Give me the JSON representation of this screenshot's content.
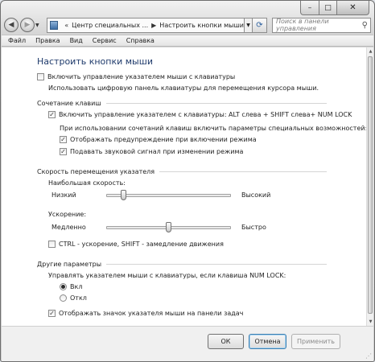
{
  "window": {
    "caption": {
      "minimize": "–",
      "maximize": "□",
      "close": "✕"
    }
  },
  "nav": {
    "back_glyph": "◀",
    "forward_glyph": "▶",
    "breadcrumb": [
      "Центр специальных ...",
      "Настроить кнопки мыши"
    ],
    "search_placeholder": "Поиск в панели управления"
  },
  "menu": [
    "Файл",
    "Правка",
    "Вид",
    "Сервис",
    "Справка"
  ],
  "page": {
    "title": "Настроить кнопки мыши",
    "enable_mousekeys": {
      "label": "Включить управление указателем мыши с клавиатуры",
      "checked": false
    },
    "enable_description": "Использовать цифровую панель клавиатуры для перемещения курсора мыши.",
    "shortcut": {
      "heading": "Сочетание клавиш",
      "enable_shortcut": {
        "label": "Включить управление указателем с клавиатуры: ALT слева + SHIFT слева+ NUM LOCK",
        "checked": true
      },
      "info": "При использовании сочетаний клавиш включить параметры специальных возможностей:",
      "warning": {
        "label": "Отображать предупреждение при включении режима",
        "checked": true
      },
      "sound": {
        "label": "Подавать звуковой сигнал при изменении режима",
        "checked": true
      }
    },
    "speed": {
      "heading": "Скорость перемещения указателя",
      "top_speed_label": "Наибольшая скорость:",
      "top_speed_min": "Низкий",
      "top_speed_max": "Высокий",
      "top_speed_value": 0.12,
      "accel_label": "Ускорение:",
      "accel_min": "Медленно",
      "accel_max": "Быстро",
      "accel_value": 0.5,
      "ctrl_shift": {
        "label": "CTRL - ускорение, SHIFT - замедление движения",
        "checked": false
      }
    },
    "other": {
      "heading": "Другие параметры",
      "numlock_label": "Управлять указателем мыши с клавиатуры, если клавиша NUM LOCK:",
      "on": {
        "label": "Вкл",
        "selected": true
      },
      "off": {
        "label": "Откл",
        "selected": false
      },
      "taskbar_icon": {
        "label": "Отображать значок указателя мыши на панели задач",
        "checked": true
      }
    }
  },
  "footer": {
    "ok": "ОК",
    "cancel": "Отмена",
    "apply": "Применить"
  }
}
